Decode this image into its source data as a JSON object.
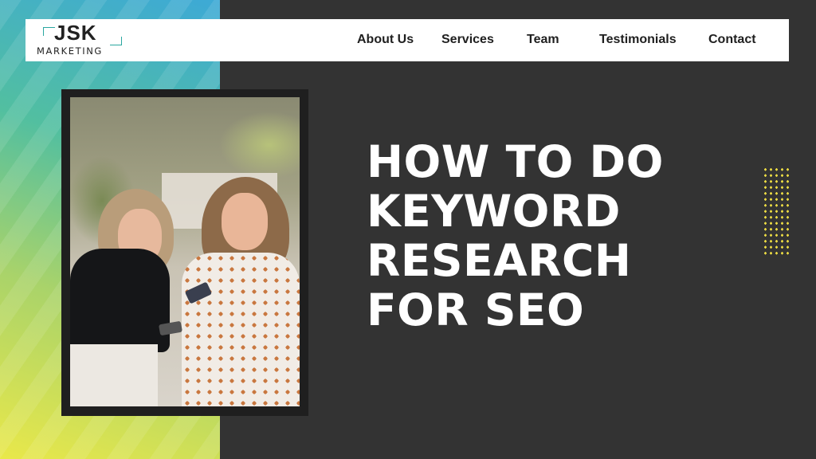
{
  "logo": {
    "main": "JSK",
    "sub": "MARKETING"
  },
  "nav": {
    "items": [
      {
        "label": "About Us"
      },
      {
        "label": "Services"
      },
      {
        "label": "Team"
      },
      {
        "label": "Testimonials"
      },
      {
        "label": "Contact"
      }
    ]
  },
  "hero": {
    "title_lines": [
      "HOW TO DO",
      "KEYWORD",
      "RESEARCH",
      "FOR SEO"
    ]
  },
  "colors": {
    "background": "#333333",
    "accent_teal": "#2aa7a0",
    "accent_yellow": "#e9d943",
    "gradient_top": "#3da9d6",
    "gradient_bottom": "#e9e84a"
  }
}
